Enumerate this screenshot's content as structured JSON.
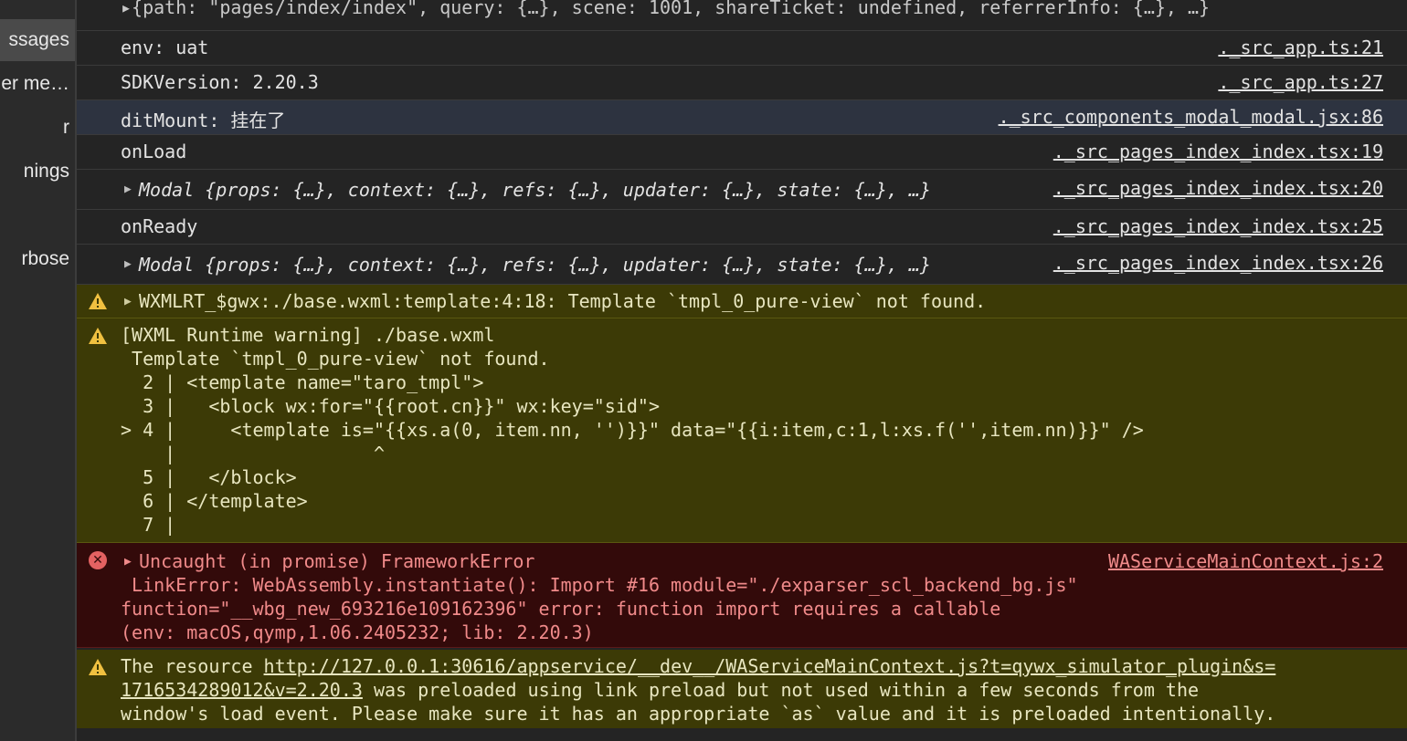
{
  "sidebar": {
    "items": [
      {
        "label": "ssages"
      },
      {
        "label": "er me…"
      },
      {
        "label": "r"
      },
      {
        "label": "nings"
      },
      {
        "label": "rbose"
      }
    ]
  },
  "console": {
    "top_partial": "▸{path: \"pages/index/index\", query: {…}, scene: 1001, shareTicket: undefined, referrerInfo: {…}, …}",
    "rows": [
      {
        "msg": "env: uat",
        "src": "._src_app.ts:21"
      },
      {
        "msg": "SDKVersion: 2.20.3",
        "src": "._src_app.ts:27"
      },
      {
        "msg": "ditMount: 挂在了",
        "src": "._src_components_modal_modal.jsx:86"
      },
      {
        "msg": "onLoad",
        "src": "._src_pages_index_index.tsx:19"
      },
      {
        "msg": "Modal {props: {…}, context: {…}, refs: {…}, updater: {…}, state: {…}, …}",
        "src": "._src_pages_index_index.tsx:20"
      },
      {
        "msg": "onReady",
        "src": "._src_pages_index_index.tsx:25"
      },
      {
        "msg": "Modal {props: {…}, context: {…}, refs: {…}, updater: {…}, state: {…}, …}",
        "src": "._src_pages_index_index.tsx:26"
      }
    ],
    "warn1": "WXMLRT_$gwx:./base.wxml:template:4:18: Template `tmpl_0_pure-view` not found.",
    "warn2_lines": [
      "[WXML Runtime warning] ./base.wxml",
      " Template `tmpl_0_pure-view` not found.",
      "  2 | <template name=\"taro_tmpl\">",
      "  3 |   <block wx:for=\"{{root.cn}}\" wx:key=\"sid\">",
      "> 4 |     <template is=\"{{xs.a(0, item.nn, '')}}\" data=\"{{i:item,c:1,l:xs.f('',item.nn)}}\" />",
      "    |                  ^",
      "  5 |   </block>",
      "  6 | </template>",
      "  7 |"
    ],
    "error": {
      "title": "Uncaught (in promise) FrameworkError",
      "src": "WAServiceMainContext.js:2",
      "lines": [
        " LinkError: WebAssembly.instantiate(): Import #16 module=\"./exparser_scl_backend_bg.js\"",
        "function=\"__wbg_new_693216e109162396\" error: function import requires a callable",
        "(env: macOS,qymp,1.06.2405232; lib: 2.20.3)"
      ]
    },
    "warn3": {
      "prefix": "The resource ",
      "link1": "http://127.0.0.1:30616/appservice/__dev__/WAServiceMainContext.js?t=qywx_simulator_plugin&s=",
      "link2": "1716534289012&v=2.20.3",
      "rest2": " was preloaded using link preload but not used within a few seconds from the",
      "line3": "window's load event. Please make sure it has an appropriate `as` value and it is preloaded intentionally."
    }
  },
  "colors": {
    "warning_bg": "#3c3a06",
    "error_bg": "#330a0a",
    "error_text": "#f08a8a",
    "warning_icon": "#f0c040"
  }
}
